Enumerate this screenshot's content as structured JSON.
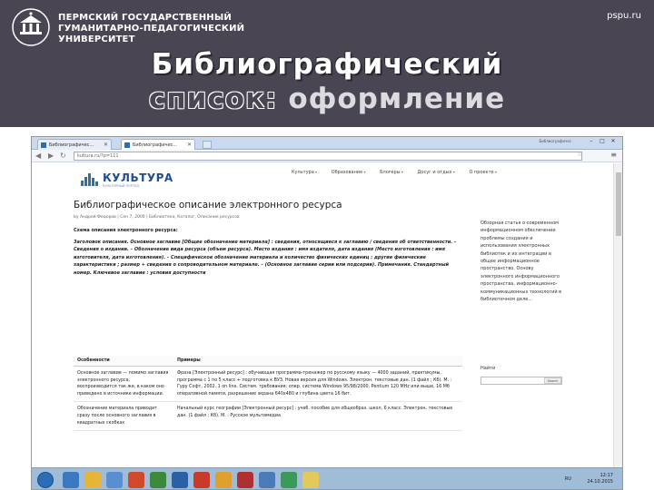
{
  "header": {
    "university_lines": [
      "ПЕРМСКИЙ ГОСУДАРСТВЕННЫЙ",
      "ГУМАНИТАРНО-ПЕДАГОГИЧЕСКИЙ",
      "УНИВЕРСИТЕТ"
    ],
    "site": "pspu.ru",
    "title_line1": "Библиографический",
    "title_line2_dark": "список:",
    "title_line2_light": "оформление"
  },
  "browser": {
    "tabs": [
      {
        "label": "Библиографичес..."
      },
      {
        "label": "Библиографичес..."
      }
    ],
    "window_label": "Библиографичес",
    "url": "kultura.ru/?p=111",
    "site_name": "КУЛЬТУРА",
    "site_tagline": "КУЛЬТУРНЫЙ ПОРТАЛ",
    "nav": [
      "Культура",
      "Образование",
      "Блогеры",
      "Досуг и отдых",
      "О проекте"
    ],
    "article_title": "Библиографическое описание электронного ресурса",
    "article_meta": "by Андрей Федоров | Сен 7, 2000 | Библиотека, Каталог, Описание ресурсов",
    "scheme_heading": "Схема описания электронного ресурса:",
    "scheme_text": "Заголовок описания. Основное заглавие [Общее обозначение материала] : сведения, относящиеся к заглавию / сведения об ответственности. – Сведения о издании. – Обозначение вида ресурса (объем ресурса). Место издания : имя издателя, дата издания (Место изготовления : имя изготовителя, дата изготовления). – Специфическое обозначение материала и количество физических единиц : другие физические характеристики ; размер + сведения о сопроводительном материале. – (Основное заглавие серии или подсерии). Примечания. Стандартный номер. Ключевое заглавие : условия доступности",
    "table_headers": [
      "Особенности",
      "Примеры"
    ],
    "table_rows": [
      {
        "feature": "Основное заглавие — помимо заглавия электронного ресурса, воспроизводится так же, в каком оно приведено в источнике информации.",
        "example": "Фраза [Электронный ресурс] : обучающая программа-тренажер по русскому языку — 4000 заданий, практикумы, программа с 1 по 5 класс + подготовка к ВУЗ. Новая версия для Windows. Электрон. текстовые дан. (1 файл ; Кб). М. : Гуру Софт, 2002. 1 on line. Систем. требования: опер. система Windows 95/98/2000, Pentium 120 MHz или выше, 16 Мб оперативной памяти, разрешение экрана 640х480 и глубина цвета 16 бит."
      },
      {
        "feature": "Обозначение материала приводит сразу после основного заглавия в квадратных скобках",
        "example": "Начальный курс географии [Электронный ресурс] : учеб. пособие для общеобраз. школ, 6 класс. Электрон. текстовые дан. (1 файл ; Кб). М. : Русское мультимедиа"
      }
    ],
    "aside_text": "Обзорная статья о современном информационном обеспечении проблемы создания и использования электронных библиотек и их интеграции в общее информационное пространство. Основу электронного информационного пространства, информационно-коммуникационных технологий в библиотечном деле...",
    "find_label": "Найти",
    "find_button": "Search",
    "clock_time": "12:17",
    "clock_date": "24.10.2015",
    "tray_lang": "RU"
  }
}
